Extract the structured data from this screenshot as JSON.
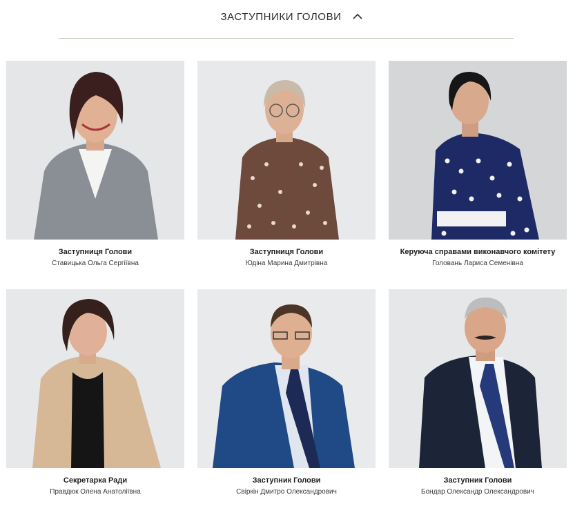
{
  "section": {
    "title": "ЗАСТУПНИКИ ГОЛОВИ",
    "toggle_icon": "chevron-up-icon"
  },
  "members": [
    {
      "role": "Заступниця Голови",
      "name": "Ставицька Ольга Сергіївна",
      "photo": "portrait-woman-gray-blazer"
    },
    {
      "role": "Заступниця Голови",
      "name": "Юдіна Марина Дмитрівна",
      "photo": "portrait-woman-brown-polka-dot-blouse"
    },
    {
      "role": "Керуюча справами виконавчого комітету",
      "name": "Головань Лариса Семенівна",
      "photo": "portrait-woman-navy-polka-dot-dress"
    },
    {
      "role": "Секретарка Ради",
      "name": "Правдюк Олена Анатоліївна",
      "photo": "portrait-woman-beige-jacket"
    },
    {
      "role": "Заступник Голови",
      "name": "Свіркін Дмитро Олександрович",
      "photo": "portrait-man-blue-suit-glasses"
    },
    {
      "role": "Заступник Голови",
      "name": "Бондар Олександр Олександрович",
      "photo": "portrait-man-dark-suit-mustache"
    }
  ],
  "colors": {
    "divider": "#b8cdb9",
    "photo_background": "#e6e8ea"
  }
}
